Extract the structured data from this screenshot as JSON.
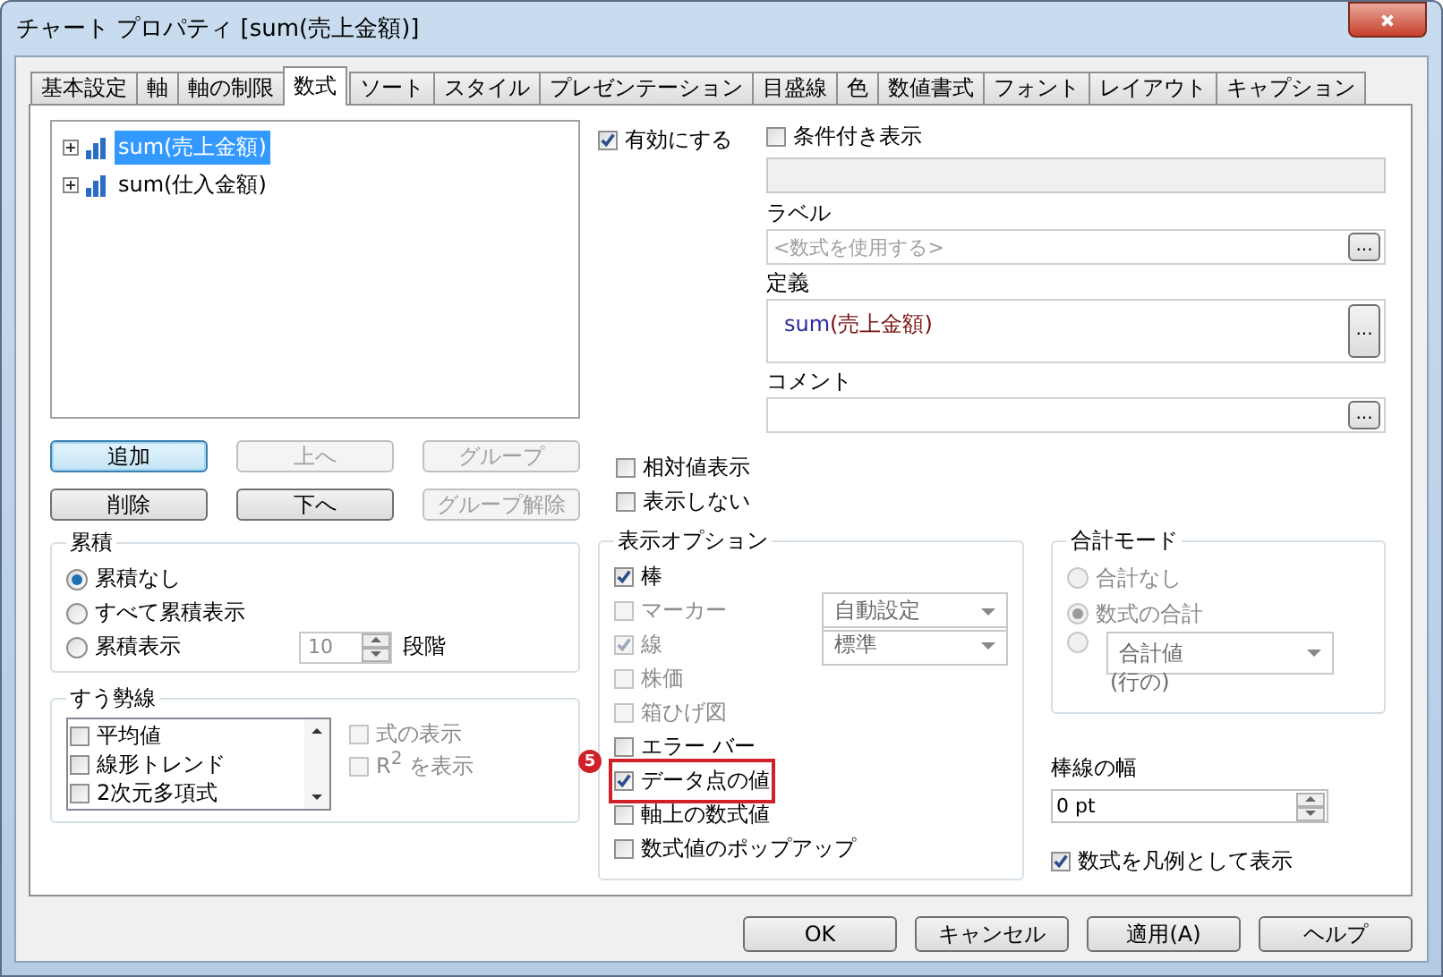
{
  "window": {
    "title": "チャート プロパティ [sum(売上金額)]"
  },
  "tabs": [
    {
      "label": "基本設定",
      "selected": false
    },
    {
      "label": "軸",
      "selected": false
    },
    {
      "label": "軸の制限",
      "selected": false
    },
    {
      "label": "数式",
      "selected": true
    },
    {
      "label": "ソート",
      "selected": false
    },
    {
      "label": "スタイル",
      "selected": false
    },
    {
      "label": "プレゼンテーション",
      "selected": false
    },
    {
      "label": "目盛線",
      "selected": false
    },
    {
      "label": "色",
      "selected": false
    },
    {
      "label": "数値書式",
      "selected": false
    },
    {
      "label": "フォント",
      "selected": false
    },
    {
      "label": "レイアウト",
      "selected": false
    },
    {
      "label": "キャプション",
      "selected": false
    }
  ],
  "expressions": [
    {
      "label": "sum(売上金額)",
      "selected": true
    },
    {
      "label": "sum(仕入金額)",
      "selected": false
    }
  ],
  "expression_buttons": [
    {
      "label": "追加",
      "disabled": false,
      "focused": true
    },
    {
      "label": "上へ",
      "disabled": true,
      "focused": false
    },
    {
      "label": "グループ",
      "disabled": true,
      "focused": false
    },
    {
      "label": "削除",
      "disabled": false,
      "focused": false
    },
    {
      "label": "下へ",
      "disabled": false,
      "focused": false
    },
    {
      "label": "グループ解除",
      "disabled": true,
      "focused": false
    }
  ],
  "enable": {
    "label": "有効にする",
    "checked": true
  },
  "conditional": {
    "label": "条件付き表示",
    "checked": false
  },
  "label_field": {
    "label": "ラベル",
    "placeholder": "<数式を使用する>",
    "button": "..."
  },
  "definition": {
    "label": "定義",
    "tokens": [
      {
        "text": "sum",
        "kind": "function"
      },
      {
        "text": "(売上金額)",
        "kind": "field"
      }
    ],
    "button": "..."
  },
  "comment": {
    "label": "コメント",
    "button": "..."
  },
  "relative": {
    "label": "相対値表示",
    "checked": false
  },
  "invisible": {
    "label": "表示しない",
    "checked": false
  },
  "accumulation": {
    "title": "累積",
    "options": [
      {
        "label": "累積なし",
        "selected": true
      },
      {
        "label": "すべて累積表示",
        "selected": false
      },
      {
        "label": "累積表示",
        "selected": false
      }
    ],
    "steps": "10",
    "steps_unit": "段階"
  },
  "trendlines": {
    "title": "すう勢線",
    "items": [
      {
        "label": "平均値",
        "checked": false
      },
      {
        "label": "線形トレンド",
        "checked": false
      },
      {
        "label": "2次元多項式",
        "checked": false
      }
    ],
    "options": [
      {
        "label": "式の表示",
        "checked": false
      },
      {
        "label": "R$^{2}$ を表示",
        "checked": false
      }
    ]
  },
  "display_options": {
    "title": "表示オプション",
    "items": [
      {
        "label": "棒",
        "checked": true,
        "disabled": false,
        "highlighted": false
      },
      {
        "label": "マーカー",
        "checked": false,
        "disabled": true,
        "dropdown": "自動設定",
        "highlighted": false
      },
      {
        "label": "線",
        "checked": true,
        "disabled": true,
        "dropdown": "標準",
        "highlighted": false
      },
      {
        "label": "株価",
        "checked": false,
        "disabled": true,
        "highlighted": false
      },
      {
        "label": "箱ひげ図",
        "checked": false,
        "disabled": true,
        "highlighted": false
      },
      {
        "label": "エラー バー",
        "checked": false,
        "disabled": false,
        "highlighted": false
      },
      {
        "label": "データ点の値",
        "checked": true,
        "disabled": false,
        "highlighted": true,
        "badge": "5"
      },
      {
        "label": "軸上の数式値",
        "checked": false,
        "disabled": false,
        "highlighted": false
      },
      {
        "label": "数式値のポップアップ",
        "checked": false,
        "disabled": false,
        "highlighted": false
      }
    ]
  },
  "total_mode": {
    "title": "合計モード",
    "options": [
      {
        "label": "合計なし",
        "selected": false
      },
      {
        "label": "数式の合計",
        "selected": true
      },
      {
        "dropdown": "合計値",
        "note": "(行の)",
        "selected": false
      }
    ]
  },
  "bar_width": {
    "label": "棒線の幅",
    "value": "0 pt"
  },
  "legend": {
    "label": "数式を凡例として表示",
    "checked": true
  },
  "footer_buttons": [
    "OK",
    "キャンセル",
    "適用(A)",
    "ヘルプ"
  ]
}
